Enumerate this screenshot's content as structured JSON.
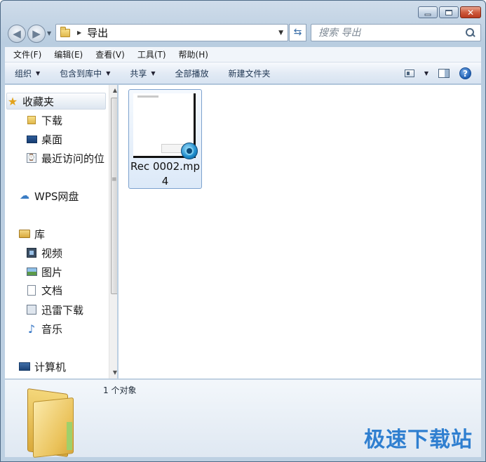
{
  "window": {
    "min_label": "minimize",
    "max_label": "maximize",
    "close_glyph": "✕"
  },
  "address": {
    "crumb": "导出",
    "back_glyph": "◀",
    "forward_glyph": "▶",
    "refresh_glyph": "⇆"
  },
  "search": {
    "placeholder": "搜索 导出"
  },
  "menu": [
    "文件(F)",
    "编辑(E)",
    "查看(V)",
    "工具(T)",
    "帮助(H)"
  ],
  "toolbar": {
    "organize": "组织",
    "include": "包含到库中",
    "share": "共享",
    "play_all": "全部播放",
    "new_folder": "新建文件夹",
    "help_glyph": "?"
  },
  "nav": {
    "favorites": "收藏夹",
    "downloads": "下载",
    "desktop": "桌面",
    "recent": "最近访问的位",
    "wps": "WPS网盘",
    "libraries": "库",
    "videos": "视频",
    "pictures": "图片",
    "documents": "文档",
    "thunder": "迅雷下载",
    "music": "音乐",
    "computer": "计算机"
  },
  "files": [
    {
      "name": "Rec 0002.mp4",
      "icon": "video-file-icon"
    }
  ],
  "details": {
    "count": "1 个对象"
  },
  "watermark": "极速下载站",
  "colors": {
    "accent": "#2f7fd0",
    "selection": "#dce9f8"
  }
}
